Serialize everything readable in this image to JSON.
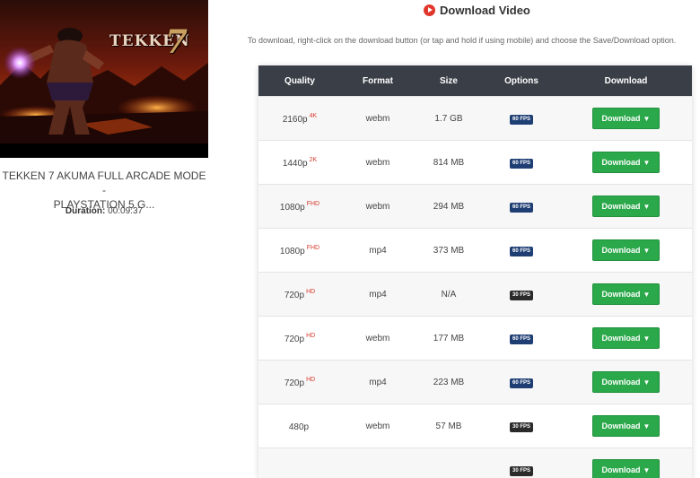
{
  "colors": {
    "header_bg": "#3a3f47",
    "download_green": "#2aa84a",
    "quality_badge_red": "#d63b2f",
    "fps60_badge": "#1f3f74",
    "fps30_badge": "#2b2b2b",
    "play_icon_red": "#e0362b"
  },
  "video": {
    "thumbnail_logo": "TEKKEN",
    "thumbnail_logo_number": "7",
    "title_line1": "TEKKEN 7 AKUMA FULL ARCADE MODE -",
    "title_line2": "PLAYSTATION 5 G...",
    "duration_label": "Duration:",
    "duration_value": "00:09:37"
  },
  "heading": {
    "icon": "play-circle-icon",
    "title": "Download Video"
  },
  "instructions": "To download, right-click on the download button (or tap and hold if using mobile) and choose the Save/Download option.",
  "table": {
    "headers": {
      "quality": "Quality",
      "format": "Format",
      "size": "Size",
      "options": "Options",
      "download": "Download"
    },
    "download_label": "Download",
    "caret": "▼",
    "rows": [
      {
        "quality": "2160p",
        "badge": "4K",
        "format": "webm",
        "size": "1.7 GB",
        "fps": "60 FPS"
      },
      {
        "quality": "1440p",
        "badge": "2K",
        "format": "webm",
        "size": "814 MB",
        "fps": "60 FPS"
      },
      {
        "quality": "1080p",
        "badge": "FHD",
        "format": "webm",
        "size": "294 MB",
        "fps": "60 FPS"
      },
      {
        "quality": "1080p",
        "badge": "FHD",
        "format": "mp4",
        "size": "373 MB",
        "fps": "60 FPS"
      },
      {
        "quality": "720p",
        "badge": "HD",
        "format": "mp4",
        "size": "N/A",
        "fps": "30 FPS"
      },
      {
        "quality": "720p",
        "badge": "HD",
        "format": "webm",
        "size": "177 MB",
        "fps": "60 FPS"
      },
      {
        "quality": "720p",
        "badge": "HD",
        "format": "mp4",
        "size": "223 MB",
        "fps": "60 FPS"
      },
      {
        "quality": "480p",
        "badge": "",
        "format": "webm",
        "size": "57 MB",
        "fps": "30 FPS"
      },
      {
        "quality": "",
        "badge": "",
        "format": "",
        "size": "",
        "fps": "30 FPS"
      }
    ]
  }
}
